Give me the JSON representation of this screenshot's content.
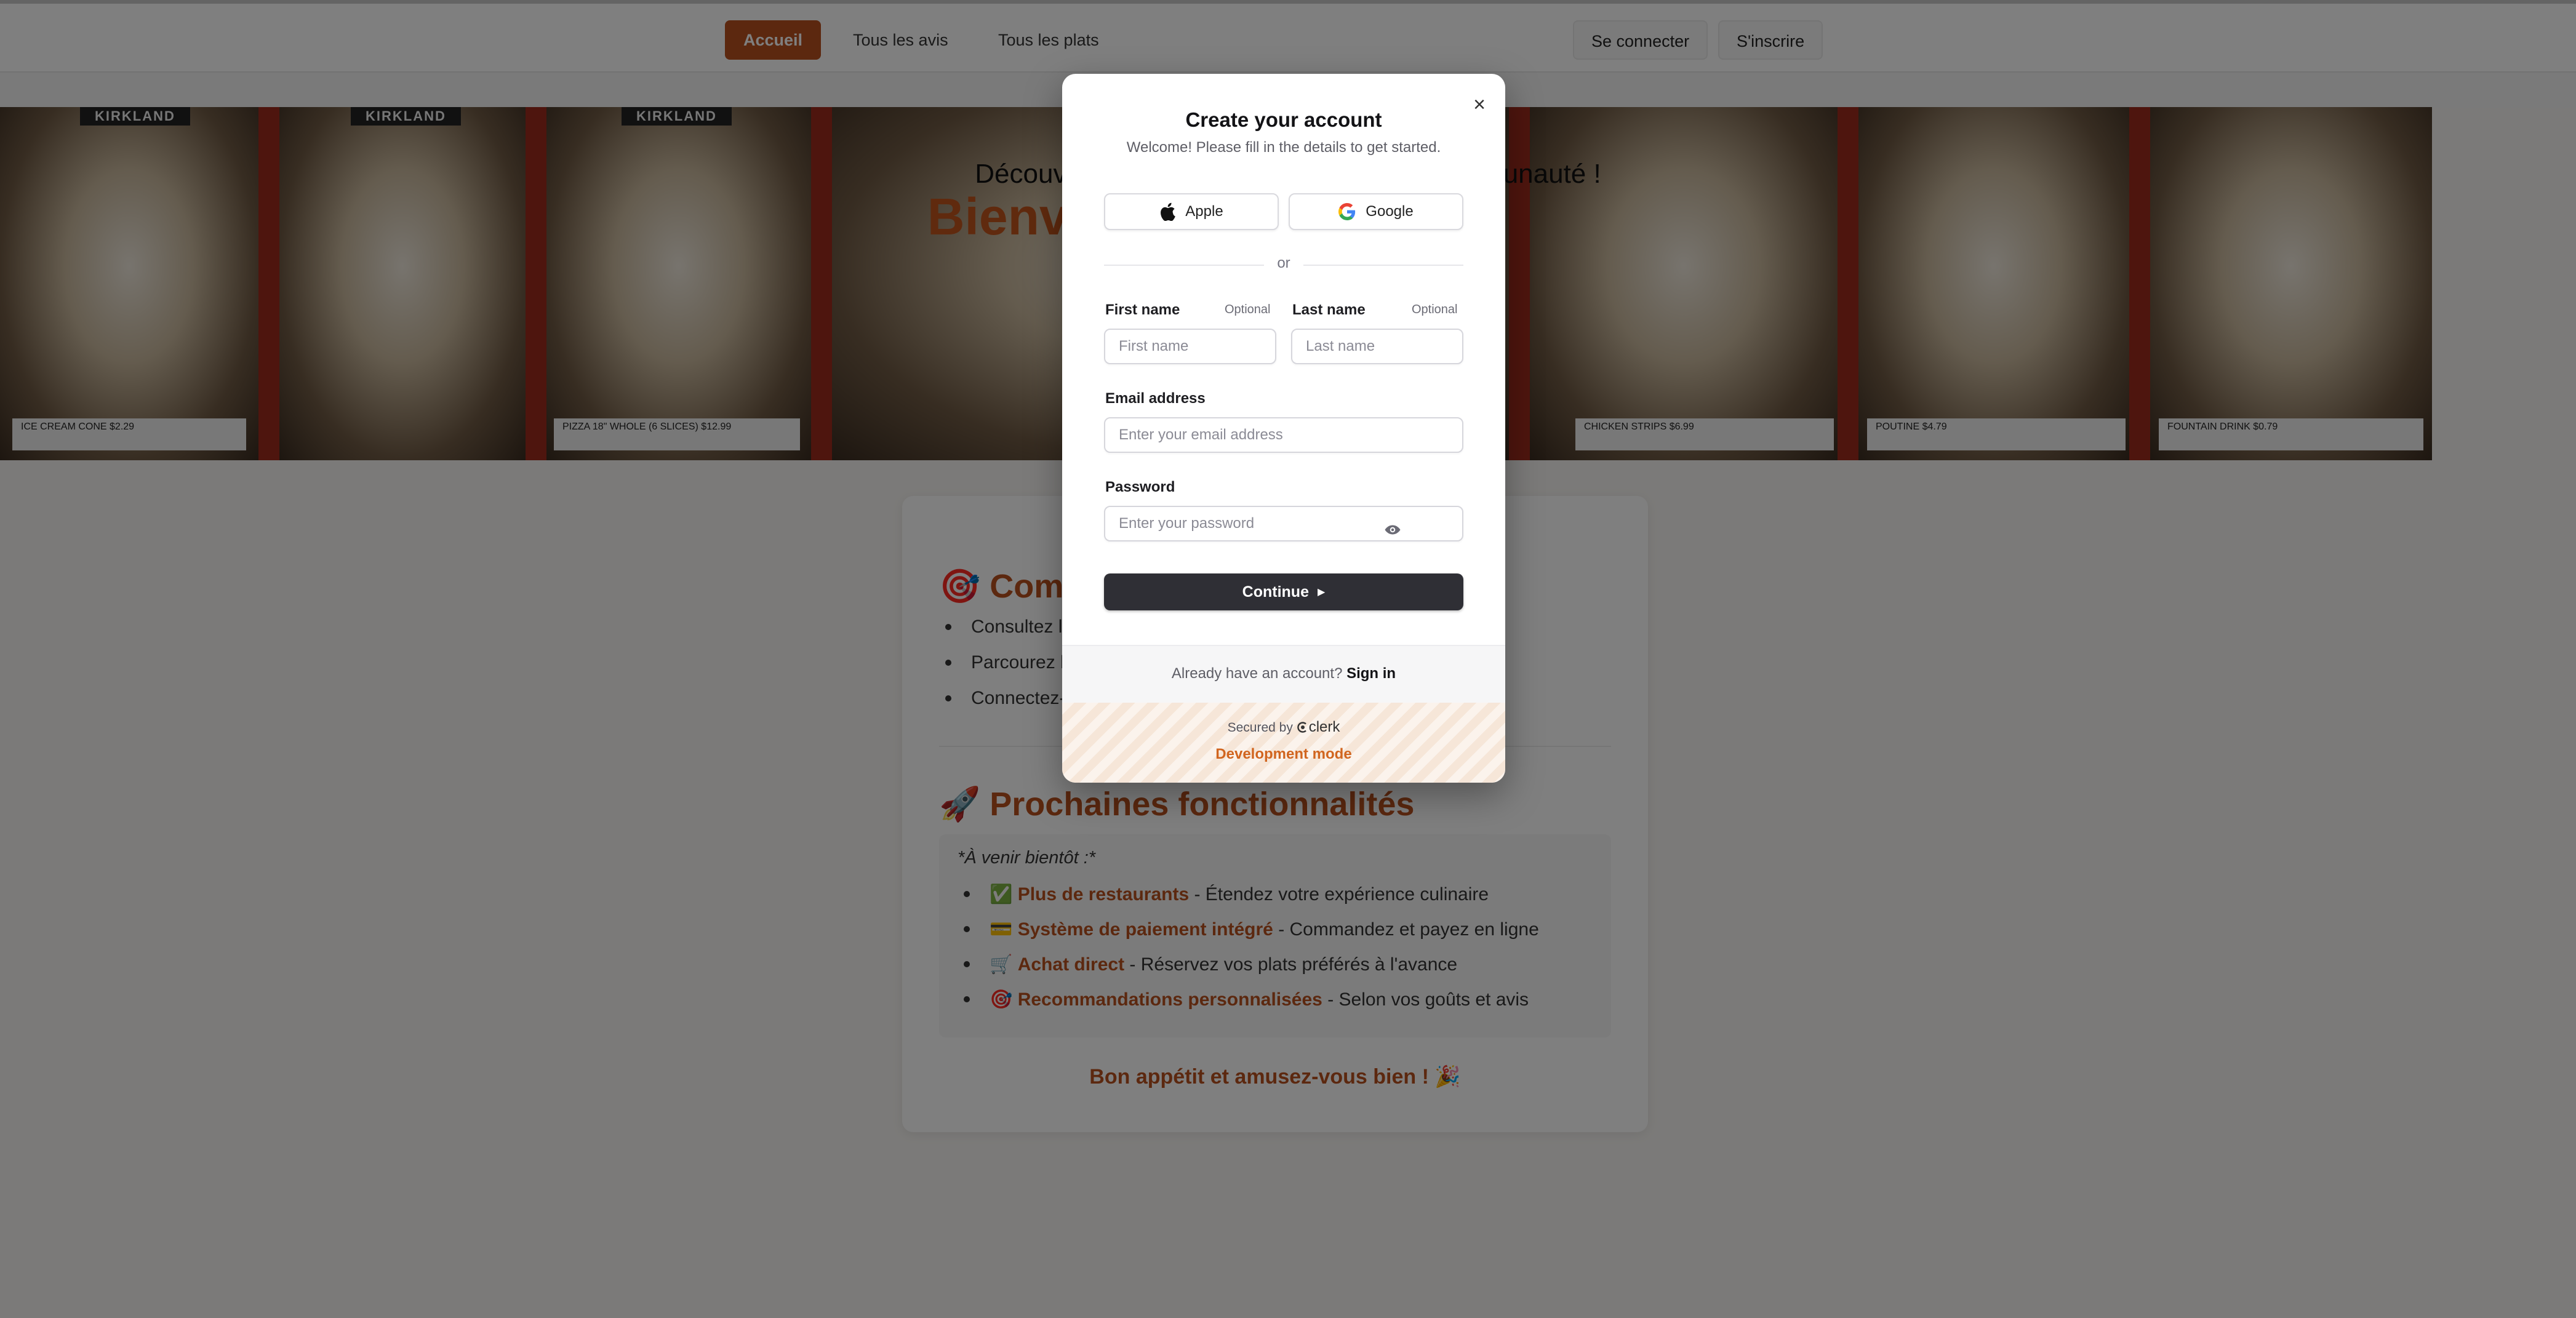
{
  "nav": {
    "home": "Accueil",
    "reviews": "Tous les avis",
    "dishes": "Tous les plats",
    "login": "Se connecter",
    "signup": "S'inscrire"
  },
  "hero": {
    "title": "Bienvenue sur Costco !",
    "subtitle": "Découvrez, partagez et notez avec la communauté !",
    "panel_labels": [
      "KIRKLAND",
      "KIRKLAND",
      "KIRKLAND"
    ],
    "captions": [
      "ICE CREAM CONE  $2.29",
      "PIZZA 18\" WHOLE (6 SLICES)  $12.99",
      "CHICKEN STRIPS  $6.99",
      "POUTINE  $4.79",
      "FOUNTAIN DRINK  $0.79"
    ]
  },
  "card": {
    "section1_icon": "🎯",
    "section1_title": "Comment ça marche",
    "section1_items": [
      "Consultez les avis",
      "Parcourez les plats",
      "Connectez-vous"
    ],
    "section2_icon": "🚀",
    "section2_title": "Prochaines fonctionnalités",
    "coming_intro": "*À venir bientôt :*",
    "features": [
      {
        "icon": "✅",
        "title": "Plus de restaurants",
        "desc": " - Étendez votre expérience culinaire"
      },
      {
        "icon": "💳",
        "title": "Système de paiement intégré",
        "desc": " - Commandez et payez en ligne"
      },
      {
        "icon": "🛒",
        "title": "Achat direct",
        "desc": " - Réservez vos plats préférés à l'avance"
      },
      {
        "icon": "🎯",
        "title": "Recommandations personnalisées",
        "desc": " - Selon vos goûts et avis"
      }
    ],
    "closing": "Bon appétit et amusez-vous bien ! 🎉"
  },
  "modal": {
    "title": "Create your account",
    "subtitle": "Welcome! Please fill in the details to get started.",
    "apple": "Apple",
    "google": "Google",
    "or": "or",
    "first_name_label": "First name",
    "last_name_label": "Last name",
    "optional": "Optional",
    "first_name_placeholder": "First name",
    "last_name_placeholder": "Last name",
    "email_label": "Email address",
    "email_placeholder": "Enter your email address",
    "password_label": "Password",
    "password_placeholder": "Enter your password",
    "continue": "Continue",
    "have_account": "Already have an account? ",
    "sign_in": "Sign in",
    "secured_by": "Secured by ",
    "clerk": "clerk",
    "dev_mode": "Development mode"
  },
  "colors": {
    "accent": "#b8501f",
    "dev_mode": "#d1651f",
    "button_dark": "#2f2f35"
  }
}
